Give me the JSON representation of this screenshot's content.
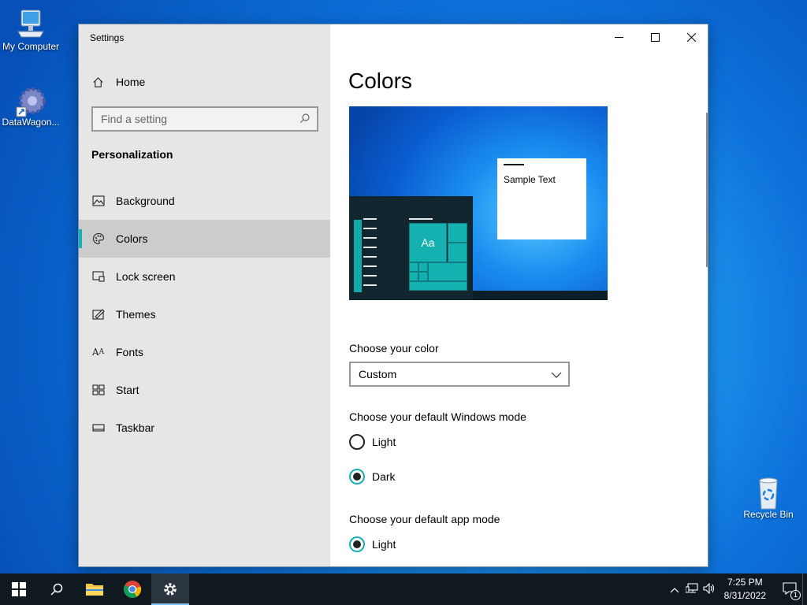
{
  "desktop": {
    "icons": [
      {
        "label": "My Computer"
      },
      {
        "label": "DataWagon..."
      },
      {
        "label": "Recycle Bin"
      }
    ]
  },
  "window": {
    "title": "Settings",
    "caption": {
      "minimize": "—",
      "maximize": "☐",
      "close": "✕"
    }
  },
  "sidebar": {
    "home": "Home",
    "search_placeholder": "Find a setting",
    "section": "Personalization",
    "items": [
      {
        "label": "Background",
        "icon": "background-icon"
      },
      {
        "label": "Colors",
        "icon": "palette-icon",
        "active": true
      },
      {
        "label": "Lock screen",
        "icon": "lock-screen-icon"
      },
      {
        "label": "Themes",
        "icon": "themes-icon"
      },
      {
        "label": "Fonts",
        "icon": "fonts-icon"
      },
      {
        "label": "Start",
        "icon": "start-icon"
      },
      {
        "label": "Taskbar",
        "icon": "taskbar-icon"
      }
    ]
  },
  "main": {
    "title": "Colors",
    "preview": {
      "sample_text": "Sample Text",
      "tile_text": "Aa"
    },
    "choose_color": {
      "label": "Choose your color",
      "value": "Custom"
    },
    "windows_mode": {
      "label": "Choose your default Windows mode",
      "options": [
        "Light",
        "Dark"
      ],
      "selected": "Dark"
    },
    "app_mode": {
      "label": "Choose your default app mode",
      "options": [
        "Light"
      ],
      "selected": "Light"
    }
  },
  "taskbar": {
    "time": "7:25 PM",
    "date": "8/31/2022",
    "notification_count": "1"
  },
  "colors": {
    "accent": "#1aafb4",
    "taskbar": "#101820",
    "sidebar": "#e6e6e6"
  }
}
